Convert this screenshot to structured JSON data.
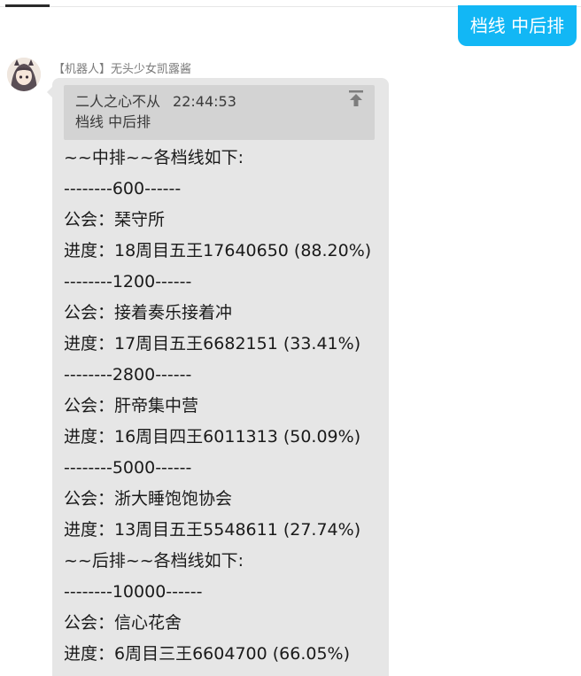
{
  "outgoing_message": "档线 中后排",
  "sender": {
    "name": "【机器人】无头少女凯露酱"
  },
  "quote": {
    "author": "二人之心不从",
    "time": "22:44:53",
    "text": "档线 中后排"
  },
  "colors": {
    "outgoing_bubble": "#12b7f5",
    "incoming_bubble": "#e6e6e6",
    "quote_background": "#d3d3d3"
  },
  "icons": {
    "quote": "jump-to-top-icon"
  },
  "lines": [
    "~~中排~~各档线如下:",
    "--------600------",
    "公会：琹守所",
    "进度：18周目五王17640650 (88.20%)",
    "--------1200------",
    "公会：接着奏乐接着冲",
    "进度：17周目五王6682151 (33.41%)",
    "--------2800------",
    "公会：肝帝集中营",
    "进度：16周目四王6011313 (50.09%)",
    "--------5000------",
    "公会：浙大睡饱饱协会",
    "进度：13周目五王5548611 (27.74%)",
    "~~后排~~各档线如下:",
    "--------10000------",
    "公会：信心花舍",
    "进度：6周目三王6604700 (66.05%)"
  ]
}
